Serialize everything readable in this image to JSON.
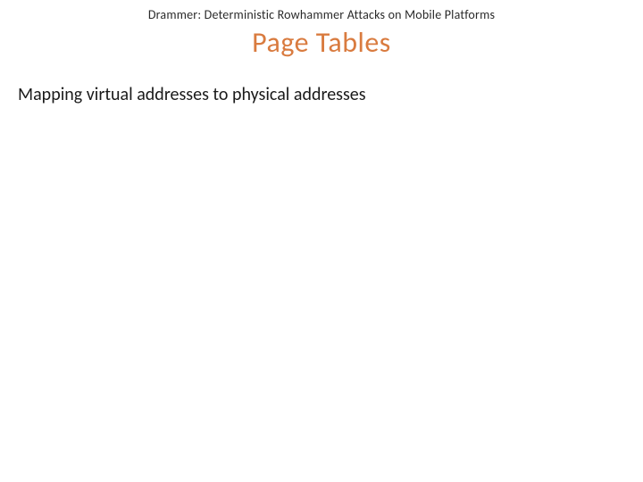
{
  "header": {
    "subtitle": "Drammer: Deterministic Rowhammer Attacks on Mobile Platforms"
  },
  "slide": {
    "title": "Page Tables",
    "body": "Mapping virtual addresses to physical addresses"
  }
}
